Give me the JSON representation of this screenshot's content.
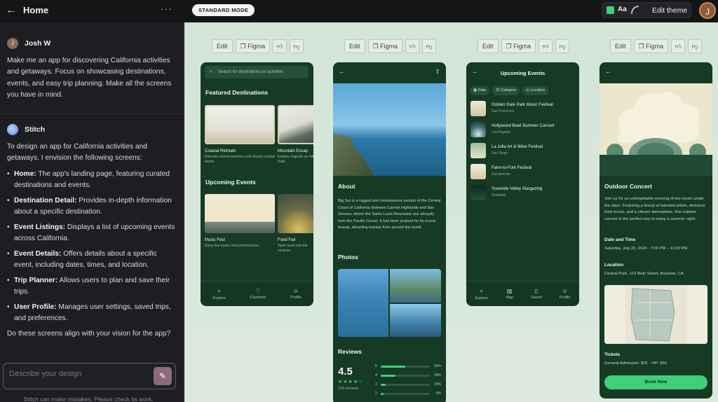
{
  "topbar": {
    "back_icon": "arrow-left-icon",
    "title": "Home",
    "more": "···",
    "mode_label": "STANDARD MODE",
    "font_label": "Aa",
    "edit_theme_label": "Edit theme",
    "avatar_initial": "J",
    "accent_color": "#3fcf7a"
  },
  "chat": {
    "user": {
      "initial": "J",
      "name": "Josh W",
      "message": "Make me an app for discovering California activities and getaways. Focus on showcasing destinations, events, and easy trip planning. Make all the screens you have in mind."
    },
    "assistant": {
      "name": "Stitch",
      "intro": "To design an app for California activities and getaways, I envision the following screens:",
      "screens": [
        {
          "title": "Home:",
          "desc": " The app's landing page, featuring curated destinations and events."
        },
        {
          "title": "Destination Detail:",
          "desc": " Provides in-depth information about a specific destination."
        },
        {
          "title": "Event Listings:",
          "desc": " Displays a list of upcoming events across California."
        },
        {
          "title": "Event Details:",
          "desc": " Offers details about a specific event, including dates, times, and location."
        },
        {
          "title": "Trip Planner:",
          "desc": " Allows users to plan and save their trips."
        },
        {
          "title": "User Profile:",
          "desc": " Manages user settings, saved trips, and preferences."
        }
      ],
      "question": "Do these screens align with your vision for the app?"
    },
    "input_placeholder": "Describe your design",
    "disclaimer": "Stitch can make mistakes. Please check its work."
  },
  "toolbar": {
    "edit": "Edit",
    "figma": "Figma"
  },
  "phone1": {
    "search_placeholder": "Search for destinations or activities",
    "featured_title": "Featured Destinations",
    "featured": [
      {
        "title": "Coastal Retreats",
        "desc": "Discover serene beaches and vibrant coastal towns."
      },
      {
        "title": "Mountain Escap",
        "desc": "Explore majestic pe hiking trails."
      }
    ],
    "events_title": "Upcoming Events",
    "events": [
      {
        "title": "Music Fest",
        "desc": "Enjoy live music and performances."
      },
      {
        "title": "Food Fair",
        "desc": "Taste local and inte cuisines."
      }
    ],
    "nav": [
      "Explore",
      "Favorites",
      "Profile"
    ]
  },
  "phone2": {
    "about_title": "About",
    "about_text": "Big Sur is a rugged and mountainous section of the Central Coast of California between Carmel Highlands and San Simeon, where the Santa Lucia Mountains rise abruptly from the Pacific Ocean. It has been praised for its scenic beauty, attracting tourists from around the world.",
    "photos_title": "Photos",
    "reviews_title": "Reviews",
    "rating": "4.5",
    "stars": "★★★★☆",
    "review_count": "120 reviews",
    "breakdown": [
      {
        "stars": "5",
        "pct": "50%",
        "value": 0.5
      },
      {
        "stars": "4",
        "pct": "30%",
        "value": 0.3
      },
      {
        "stars": "3",
        "pct": "10%",
        "value": 0.1
      },
      {
        "stars": "2",
        "pct": "5%",
        "value": 0.05
      }
    ]
  },
  "phone3": {
    "title": "Upcoming Events",
    "chips": [
      "Date",
      "Category",
      "Location"
    ],
    "events": [
      {
        "title": "Golden Gate Park Music Festival",
        "place": "San Francisco"
      },
      {
        "title": "Hollywood Bowl Summer Concert",
        "place": "Los Angeles"
      },
      {
        "title": "La Jolla Art & Wine Festival",
        "place": "San Diego"
      },
      {
        "title": "Farm-to-Fork Festival",
        "place": "Sacramento"
      },
      {
        "title": "Yosemite Valley Stargazing",
        "place": "Yosemite"
      }
    ],
    "nav": [
      "Explore",
      "Map",
      "Saved",
      "Profile"
    ]
  },
  "phone4": {
    "title": "Outdoor Concert",
    "desc": "Join us for an unforgettable evening of live music under the stars. Featuring a lineup of talented artists, delicious food trucks, and a vibrant atmosphere, this outdoor concert is the perfect way to enjoy a summer night.",
    "datetime_label": "Date and Time",
    "datetime": "Saturday, July 20, 2024 · 7:00 PM – 11:00 PM",
    "location_label": "Location",
    "location": "Central Park, 123 Main Street, Anytown, CA",
    "tickets_label": "Tickets",
    "tickets": "General Admission: $25 · VIP: $50",
    "book_label": "Book Now"
  }
}
